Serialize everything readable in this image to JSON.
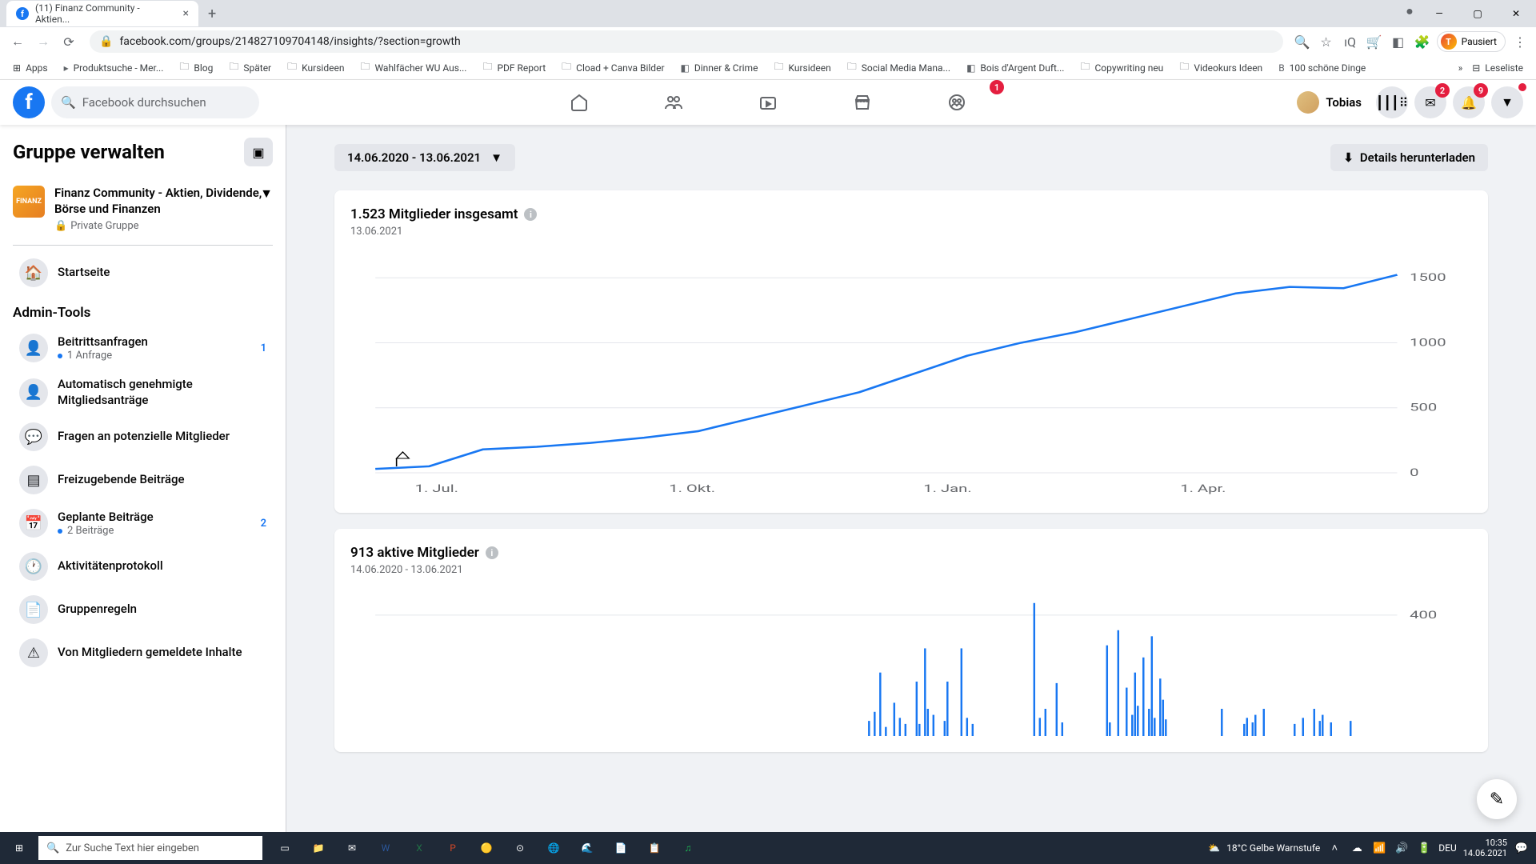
{
  "browser": {
    "tab_title": "(11) Finanz Community - Aktien...",
    "url": "facebook.com/groups/214827109704148/insights/?section=growth",
    "user_status": "Pausiert",
    "user_initial": "T",
    "bookmarks": [
      "Apps",
      "Produktsuche - Mer...",
      "Blog",
      "Später",
      "Kursideen",
      "Wahlfächer WU Aus...",
      "PDF Report",
      "Cload + Canva Bilder",
      "Dinner & Crime",
      "Kursideen",
      "Social Media Mana...",
      "Bois d'Argent Duft...",
      "Copywriting neu",
      "Videokurs Ideen",
      "100 schöne Dinge"
    ],
    "bm_more": "Leseliste"
  },
  "fb_nav": {
    "search_placeholder": "Facebook durchsuchen",
    "user_name": "Tobias",
    "badges": {
      "groups": "1",
      "messenger": "2",
      "notifications": "9"
    }
  },
  "sidebar": {
    "title": "Gruppe verwalten",
    "group_name": "Finanz Community - Aktien, Dividende, Börse und Finanzen",
    "group_av_text": "FINANZ",
    "group_privacy": "Private Gruppe",
    "home_label": "Startseite",
    "admin_section": "Admin-Tools",
    "items": [
      {
        "label": "Beitrittsanfragen",
        "sub": "1 Anfrage",
        "count": "1"
      },
      {
        "label": "Automatisch genehmigte Mitgliedsanträge"
      },
      {
        "label": "Fragen an potenzielle Mitglieder"
      },
      {
        "label": "Freizugebende Beiträge"
      },
      {
        "label": "Geplante Beiträge",
        "sub": "2 Beiträge",
        "count": "2"
      },
      {
        "label": "Aktivitätenprotokoll"
      },
      {
        "label": "Gruppenregeln"
      },
      {
        "label": "Von Mitgliedern gemeldete Inhalte"
      }
    ]
  },
  "main": {
    "date_range": "14.06.2020 - 13.06.2021",
    "download_label": "Details herunterladen",
    "card1_title": "1.523 Mitglieder insgesamt",
    "card1_sub": "13.06.2021",
    "card2_title": "913 aktive Mitglieder",
    "card2_sub": "14.06.2020 - 13.06.2021"
  },
  "chart_data": [
    {
      "type": "line",
      "title": "1.523 Mitglieder insgesamt",
      "x_ticks": [
        "1. Jul.",
        "1. Okt.",
        "1. Jan.",
        "1. Apr."
      ],
      "y_ticks": [
        0,
        500,
        1000,
        1500
      ],
      "ylim": [
        0,
        1600
      ],
      "series": [
        {
          "name": "Mitglieder",
          "color": "#1877f2",
          "x": [
            "14.06.2020",
            "01.07.2020",
            "15.07.2020",
            "01.08.2020",
            "01.09.2020",
            "01.10.2020",
            "15.10.2020",
            "01.11.2020",
            "15.11.2020",
            "01.12.2020",
            "15.12.2020",
            "01.01.2021",
            "15.01.2021",
            "01.02.2021",
            "01.03.2021",
            "01.04.2021",
            "01.05.2021",
            "20.05.2021",
            "01.06.2021",
            "13.06.2021"
          ],
          "y": [
            30,
            50,
            180,
            200,
            230,
            270,
            320,
            420,
            520,
            620,
            760,
            900,
            1000,
            1080,
            1180,
            1280,
            1380,
            1430,
            1420,
            1523
          ]
        }
      ]
    },
    {
      "type": "bar",
      "title": "913 aktive Mitglieder",
      "y_ticks": [
        400
      ],
      "ylim": [
        0,
        450
      ],
      "categories_desc": "daily 14.06.2020 - 13.06.2021",
      "values": [
        0,
        0,
        0,
        0,
        0,
        0,
        0,
        0,
        0,
        0,
        0,
        0,
        0,
        0,
        0,
        0,
        0,
        0,
        0,
        0,
        0,
        0,
        0,
        0,
        0,
        0,
        0,
        0,
        0,
        0,
        0,
        0,
        0,
        0,
        0,
        0,
        0,
        0,
        0,
        0,
        0,
        0,
        0,
        0,
        0,
        0,
        0,
        0,
        0,
        0,
        0,
        0,
        0,
        0,
        0,
        0,
        0,
        0,
        0,
        0,
        0,
        0,
        0,
        0,
        0,
        0,
        0,
        0,
        0,
        0,
        0,
        0,
        0,
        0,
        0,
        0,
        0,
        0,
        0,
        0,
        0,
        0,
        0,
        0,
        0,
        0,
        0,
        0,
        0,
        0,
        0,
        0,
        0,
        0,
        0,
        0,
        0,
        0,
        0,
        0,
        0,
        0,
        0,
        0,
        0,
        0,
        0,
        0,
        0,
        0,
        0,
        0,
        0,
        0,
        0,
        0,
        0,
        0,
        0,
        0,
        0,
        0,
        0,
        0,
        0,
        0,
        0,
        0,
        0,
        0,
        0,
        0,
        0,
        0,
        0,
        0,
        0,
        0,
        0,
        0,
        0,
        0,
        0,
        0,
        0,
        0,
        0,
        0,
        0,
        0,
        0,
        0,
        0,
        0,
        0,
        0,
        0,
        0,
        0,
        0,
        0,
        0,
        0,
        0,
        0,
        0,
        0,
        0,
        0,
        0,
        0,
        0,
        0,
        0,
        0,
        0,
        50,
        0,
        80,
        0,
        210,
        0,
        30,
        0,
        0,
        110,
        0,
        60,
        0,
        40,
        0,
        0,
        0,
        180,
        40,
        0,
        290,
        90,
        0,
        70,
        0,
        0,
        0,
        50,
        180,
        0,
        0,
        0,
        0,
        290,
        0,
        60,
        0,
        40,
        0,
        0,
        0,
        0,
        0,
        0,
        0,
        0,
        0,
        0,
        0,
        0,
        0,
        0,
        0,
        0,
        0,
        0,
        0,
        0,
        0,
        440,
        0,
        60,
        0,
        90,
        0,
        0,
        0,
        175,
        0,
        45,
        0,
        0,
        0,
        0,
        0,
        0,
        0,
        0,
        0,
        0,
        0,
        0,
        0,
        0,
        0,
        300,
        45,
        0,
        0,
        350,
        0,
        0,
        160,
        0,
        70,
        210,
        100,
        0,
        260,
        0,
        90,
        330,
        60,
        0,
        190,
        120,
        55,
        0,
        0,
        0,
        0,
        0,
        0,
        0,
        0,
        0,
        0,
        0,
        0,
        0,
        0,
        0,
        0,
        0,
        0,
        0,
        90,
        0,
        0,
        0,
        0,
        0,
        0,
        0,
        40,
        60,
        0,
        45,
        70,
        0,
        0,
        90,
        0,
        0,
        0,
        0,
        0,
        0,
        0,
        0,
        0,
        0,
        40,
        0,
        0,
        60,
        0,
        0,
        0,
        90,
        0,
        50,
        70,
        0,
        0,
        45,
        0,
        0,
        0,
        0,
        0,
        0,
        50,
        0,
        0,
        0,
        0,
        0,
        0,
        0,
        0,
        0,
        0,
        0,
        0,
        0,
        0,
        0,
        0
      ]
    }
  ],
  "taskbar": {
    "search_placeholder": "Zur Suche Text hier eingeben",
    "weather": "18°C  Gelbe Warnstufe",
    "lang": "DEU",
    "time": "10:35",
    "date": "14.06.2021"
  }
}
